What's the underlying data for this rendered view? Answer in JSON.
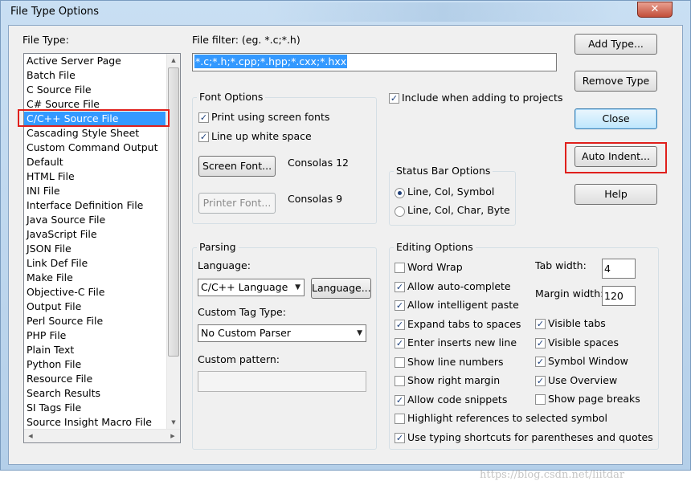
{
  "window": {
    "title": "File Type Options",
    "close_glyph": "✕"
  },
  "file_type": {
    "label": "File Type:",
    "selected_index": 4,
    "items": [
      "Active Server Page",
      "Batch File",
      "C Source File",
      "C# Source File",
      "C/C++ Source File",
      "Cascading Style Sheet",
      "Custom Command Output",
      "Default",
      "HTML File",
      "INI File",
      "Interface Definition File",
      "Java Source File",
      "JavaScript File",
      "JSON File",
      "Link Def File",
      "Make File",
      "Objective-C File",
      "Output File",
      "Perl Source File",
      "PHP File",
      "Plain Text",
      "Python File",
      "Resource File",
      "Search Results",
      "SI Tags File",
      "Source Insight Macro File"
    ]
  },
  "file_filter": {
    "label": "File filter: (eg. *.c;*.h)",
    "value": "*.c;*.h;*.cpp;*.hpp;*.cxx;*.hxx"
  },
  "font_options": {
    "title": "Font Options",
    "print_screen_fonts": {
      "label": "Print using screen fonts",
      "checked": true
    },
    "line_up_white_space": {
      "label": "Line up white space",
      "checked": true
    },
    "screen_font_button": "Screen Font...",
    "screen_font_value": "Consolas 12",
    "printer_font_button": "Printer Font...",
    "printer_font_value": "Consolas 9"
  },
  "include_projects": {
    "label": "Include when adding to projects",
    "checked": true
  },
  "status_bar": {
    "title": "Status Bar Options",
    "options": [
      {
        "label": "Line, Col, Symbol",
        "selected": true
      },
      {
        "label": "Line, Col, Char, Byte",
        "selected": false
      }
    ]
  },
  "buttons": {
    "add_type": "Add Type...",
    "remove_type": "Remove Type",
    "close": "Close",
    "auto_indent": "Auto Indent...",
    "help": "Help"
  },
  "parsing": {
    "title": "Parsing",
    "language_label": "Language:",
    "language_value": "C/C++ Language",
    "language_button": "Language...",
    "custom_tag_label": "Custom Tag Type:",
    "custom_tag_value": "No Custom Parser",
    "custom_pattern_label": "Custom pattern:",
    "custom_pattern_value": ""
  },
  "editing": {
    "title": "Editing Options",
    "tab_width_label": "Tab width:",
    "tab_width_value": "4",
    "margin_width_label": "Margin width:",
    "margin_width_value": "120",
    "left_options": [
      {
        "label": "Word Wrap",
        "checked": false
      },
      {
        "label": "Allow auto-complete",
        "checked": true
      },
      {
        "label": "Allow intelligent paste",
        "checked": true
      },
      {
        "label": "Expand tabs to spaces",
        "checked": true
      },
      {
        "label": "Enter inserts new line",
        "checked": true
      },
      {
        "label": "Show line numbers",
        "checked": false
      },
      {
        "label": "Show right margin",
        "checked": false
      },
      {
        "label": "Allow code snippets",
        "checked": true
      }
    ],
    "right_options": [
      {
        "label": "Visible tabs",
        "checked": true
      },
      {
        "label": "Visible spaces",
        "checked": true
      },
      {
        "label": "Symbol Window",
        "checked": true
      },
      {
        "label": "Use Overview",
        "checked": true
      },
      {
        "label": "Show page breaks",
        "checked": false
      }
    ],
    "bottom_options": [
      {
        "label": "Highlight references to selected symbol",
        "checked": false
      },
      {
        "label": "Use typing shortcuts for parentheses and quotes",
        "checked": true
      }
    ]
  },
  "watermark": "https://blog.csdn.net/liitdar"
}
